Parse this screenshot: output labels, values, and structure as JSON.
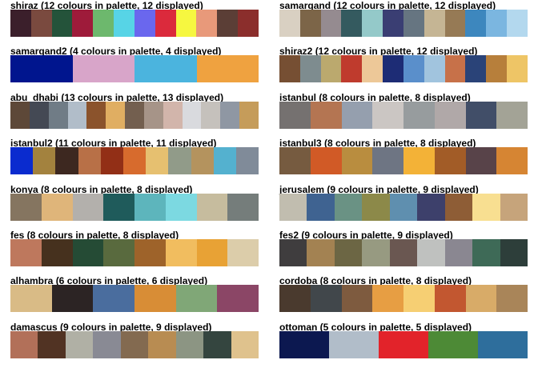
{
  "palettes": [
    {
      "name": "shiraz",
      "title": "shiraz (12 colours in palette, 12 displayed)",
      "colors": [
        "#3B1F2B",
        "#7A4A3F",
        "#24533A",
        "#9E1B3A",
        "#6DB86D",
        "#57D4E6",
        "#6A67EE",
        "#DB2A3C",
        "#F6F740",
        "#E8997A",
        "#5B3E36",
        "#8B2E2C"
      ]
    },
    {
      "name": "samarqand",
      "title": "samarqand (12 colours in palette, 12 displayed)",
      "colors": [
        "#D9D0C2",
        "#7C6548",
        "#958B90",
        "#345A5F",
        "#94C9C9",
        "#3A3E73",
        "#667581",
        "#C5B594",
        "#967A55",
        "#3D87BE",
        "#7BB6E0",
        "#B3D8EE"
      ]
    },
    {
      "name": "samarqand2",
      "title": "samarqand2 (4 colours in palette, 4 displayed)",
      "colors": [
        "#00158E",
        "#D8A5C9",
        "#4BB4DE",
        "#EFA240"
      ]
    },
    {
      "name": "shiraz2",
      "title": "shiraz2 (12 colours in palette, 12 displayed)",
      "colors": [
        "#764F33",
        "#7E8C8F",
        "#BBA96E",
        "#BF3B2D",
        "#EDC898",
        "#1D2C75",
        "#5A8FCB",
        "#A1C4DE",
        "#C77149",
        "#2A4378",
        "#B77F3B",
        "#EEC566"
      ]
    },
    {
      "name": "abu_dhabi",
      "title": "abu_dhabi (13 colours in palette, 13 displayed)",
      "colors": [
        "#5D4838",
        "#444954",
        "#707C86",
        "#B1BDC9",
        "#8B532C",
        "#E0AE62",
        "#735F4F",
        "#A69488",
        "#D2B5AB",
        "#D9DADE",
        "#C5C1BC",
        "#8F97A3",
        "#C59C5A"
      ]
    },
    {
      "name": "istanbul",
      "title": "istanbul (8 colours in palette, 8 displayed)",
      "colors": [
        "#757170",
        "#B47552",
        "#959FAE",
        "#CBC6C3",
        "#979C9E",
        "#B0A8A8",
        "#414E68",
        "#A3A396"
      ]
    },
    {
      "name": "istanbul2",
      "title": "istanbul2 (11 colours in palette, 11 displayed)",
      "colors": [
        "#0A2BCF",
        "#A3823E",
        "#3D2820",
        "#B87047",
        "#922F16",
        "#D76B2D",
        "#E6C070",
        "#919B89",
        "#B4935E",
        "#54B1CF",
        "#808B99"
      ]
    },
    {
      "name": "istanbul3",
      "title": "istanbul3 (8 colours in palette, 8 displayed)",
      "colors": [
        "#765B40",
        "#D15A26",
        "#B98D3F",
        "#6E7583",
        "#F3B237",
        "#A25C27",
        "#584349",
        "#D68533"
      ]
    },
    {
      "name": "konya",
      "title": "konya (8 colours in palette, 8 displayed)",
      "colors": [
        "#857560",
        "#DFB57A",
        "#B3B0AC",
        "#1F5B5B",
        "#5DB5BC",
        "#7CD9E1",
        "#C6BC9E",
        "#757D7B"
      ]
    },
    {
      "name": "jerusalem",
      "title": "jerusalem (9 colours in palette, 9 displayed)",
      "colors": [
        "#C1BDAF",
        "#3F6391",
        "#6A9284",
        "#8C8949",
        "#5F8FAF",
        "#3D406B",
        "#8E5D36",
        "#F8DF91",
        "#C6A47B"
      ]
    },
    {
      "name": "fes",
      "title": "fes (8 colours in palette, 8 displayed)",
      "colors": [
        "#BE785D",
        "#46311E",
        "#254B35",
        "#596A3E",
        "#9E632A",
        "#F1BD5F",
        "#E8A235",
        "#DCCDAA"
      ]
    },
    {
      "name": "fes2",
      "title": "fes2 (9 colours in palette, 9 displayed)",
      "colors": [
        "#3F3D3E",
        "#A38252",
        "#6C6644",
        "#979A81",
        "#6A5751",
        "#BFC1BF",
        "#8A8791",
        "#3E6A57",
        "#2D3E3A"
      ]
    },
    {
      "name": "alhambra",
      "title": "alhambra (6 colours in palette, 6 displayed)",
      "colors": [
        "#D9BB86",
        "#2C2424",
        "#4A6D9E",
        "#D88D36",
        "#80A777",
        "#8B4666"
      ]
    },
    {
      "name": "cordoba",
      "title": "cordoba (8 colours in palette, 8 displayed)",
      "colors": [
        "#4A3A2E",
        "#41474B",
        "#7E5B3F",
        "#E79E43",
        "#F6CF73",
        "#C25730",
        "#D8AB68",
        "#A98559"
      ]
    },
    {
      "name": "damascus",
      "title": "damascus (9 colours in palette, 9 displayed)",
      "colors": [
        "#B27059",
        "#513323",
        "#B0B0A5",
        "#898A94",
        "#836A50",
        "#B88C52",
        "#8C9583",
        "#34453F",
        "#DFC28D"
      ]
    },
    {
      "name": "ottoman",
      "title": "ottoman (5 colours in palette, 5 displayed)",
      "colors": [
        "#0C1850",
        "#B1BDC9",
        "#E2232A",
        "#4D8A36",
        "#2E6E9C"
      ]
    }
  ]
}
